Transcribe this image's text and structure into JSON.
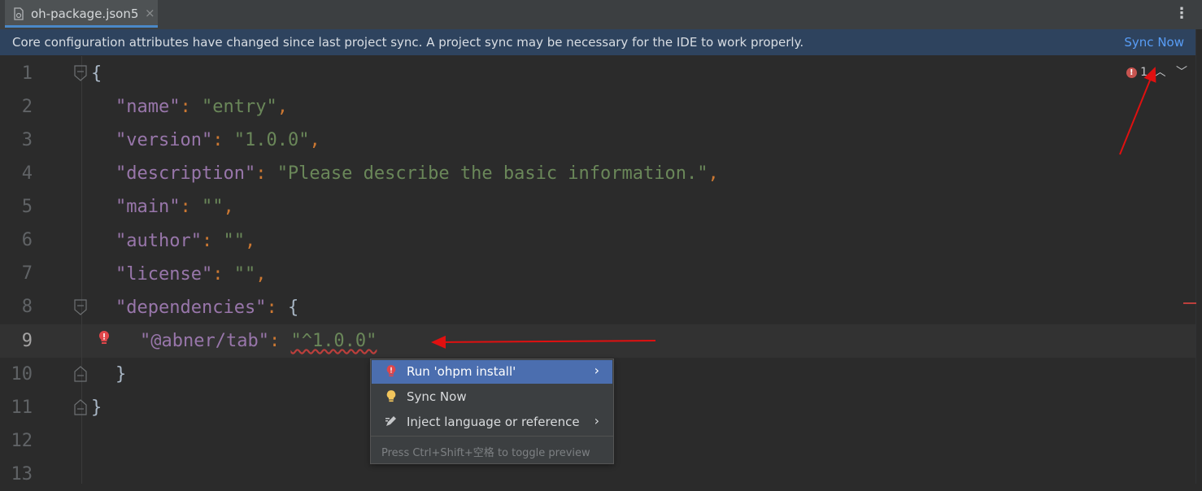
{
  "tab": {
    "filename": "oh-package.json5",
    "close": "×"
  },
  "banner": {
    "message": "Core configuration attributes have changed since last project sync. A project sync may be necessary for the IDE to work properly.",
    "action": "Sync Now"
  },
  "inspection": {
    "error_count": "1",
    "error_icon": "!"
  },
  "line_numbers": [
    "1",
    "2",
    "3",
    "4",
    "5",
    "6",
    "7",
    "8",
    "9",
    "10",
    "11",
    "12",
    "13"
  ],
  "code": {
    "l1": "{",
    "l2_key": "\"name\"",
    "l2_val": "\"entry\"",
    "l3_key": "\"version\"",
    "l3_val": "\"1.0.0\"",
    "l4_key": "\"description\"",
    "l4_val": "\"Please describe the basic information.\"",
    "l5_key": "\"main\"",
    "l5_val": "\"\"",
    "l6_key": "\"author\"",
    "l6_val": "\"\"",
    "l7_key": "\"license\"",
    "l7_val": "\"\"",
    "l8_key": "\"dependencies\"",
    "l8_brace": "{",
    "l9_key": "\"@abner/tab\"",
    "l9_val": "\"^1.0.0\"",
    "l10": "}",
    "l11": "}",
    "colon": ": ",
    "comma": ","
  },
  "popup": {
    "items": [
      {
        "label": "Run 'ohpm install'",
        "icon": "error-bulb-icon",
        "has_submenu": true
      },
      {
        "label": "Sync Now",
        "icon": "yellow-bulb-icon",
        "has_submenu": false
      },
      {
        "label": "Inject language or reference",
        "icon": "inject-pen-icon",
        "has_submenu": true
      }
    ],
    "hint": "Press Ctrl+Shift+空格 to toggle preview"
  },
  "colors": {
    "accent": "#4b6eaf",
    "link": "#589df6",
    "error": "#bc3f3c",
    "annotation_arrow": "#e01010"
  }
}
